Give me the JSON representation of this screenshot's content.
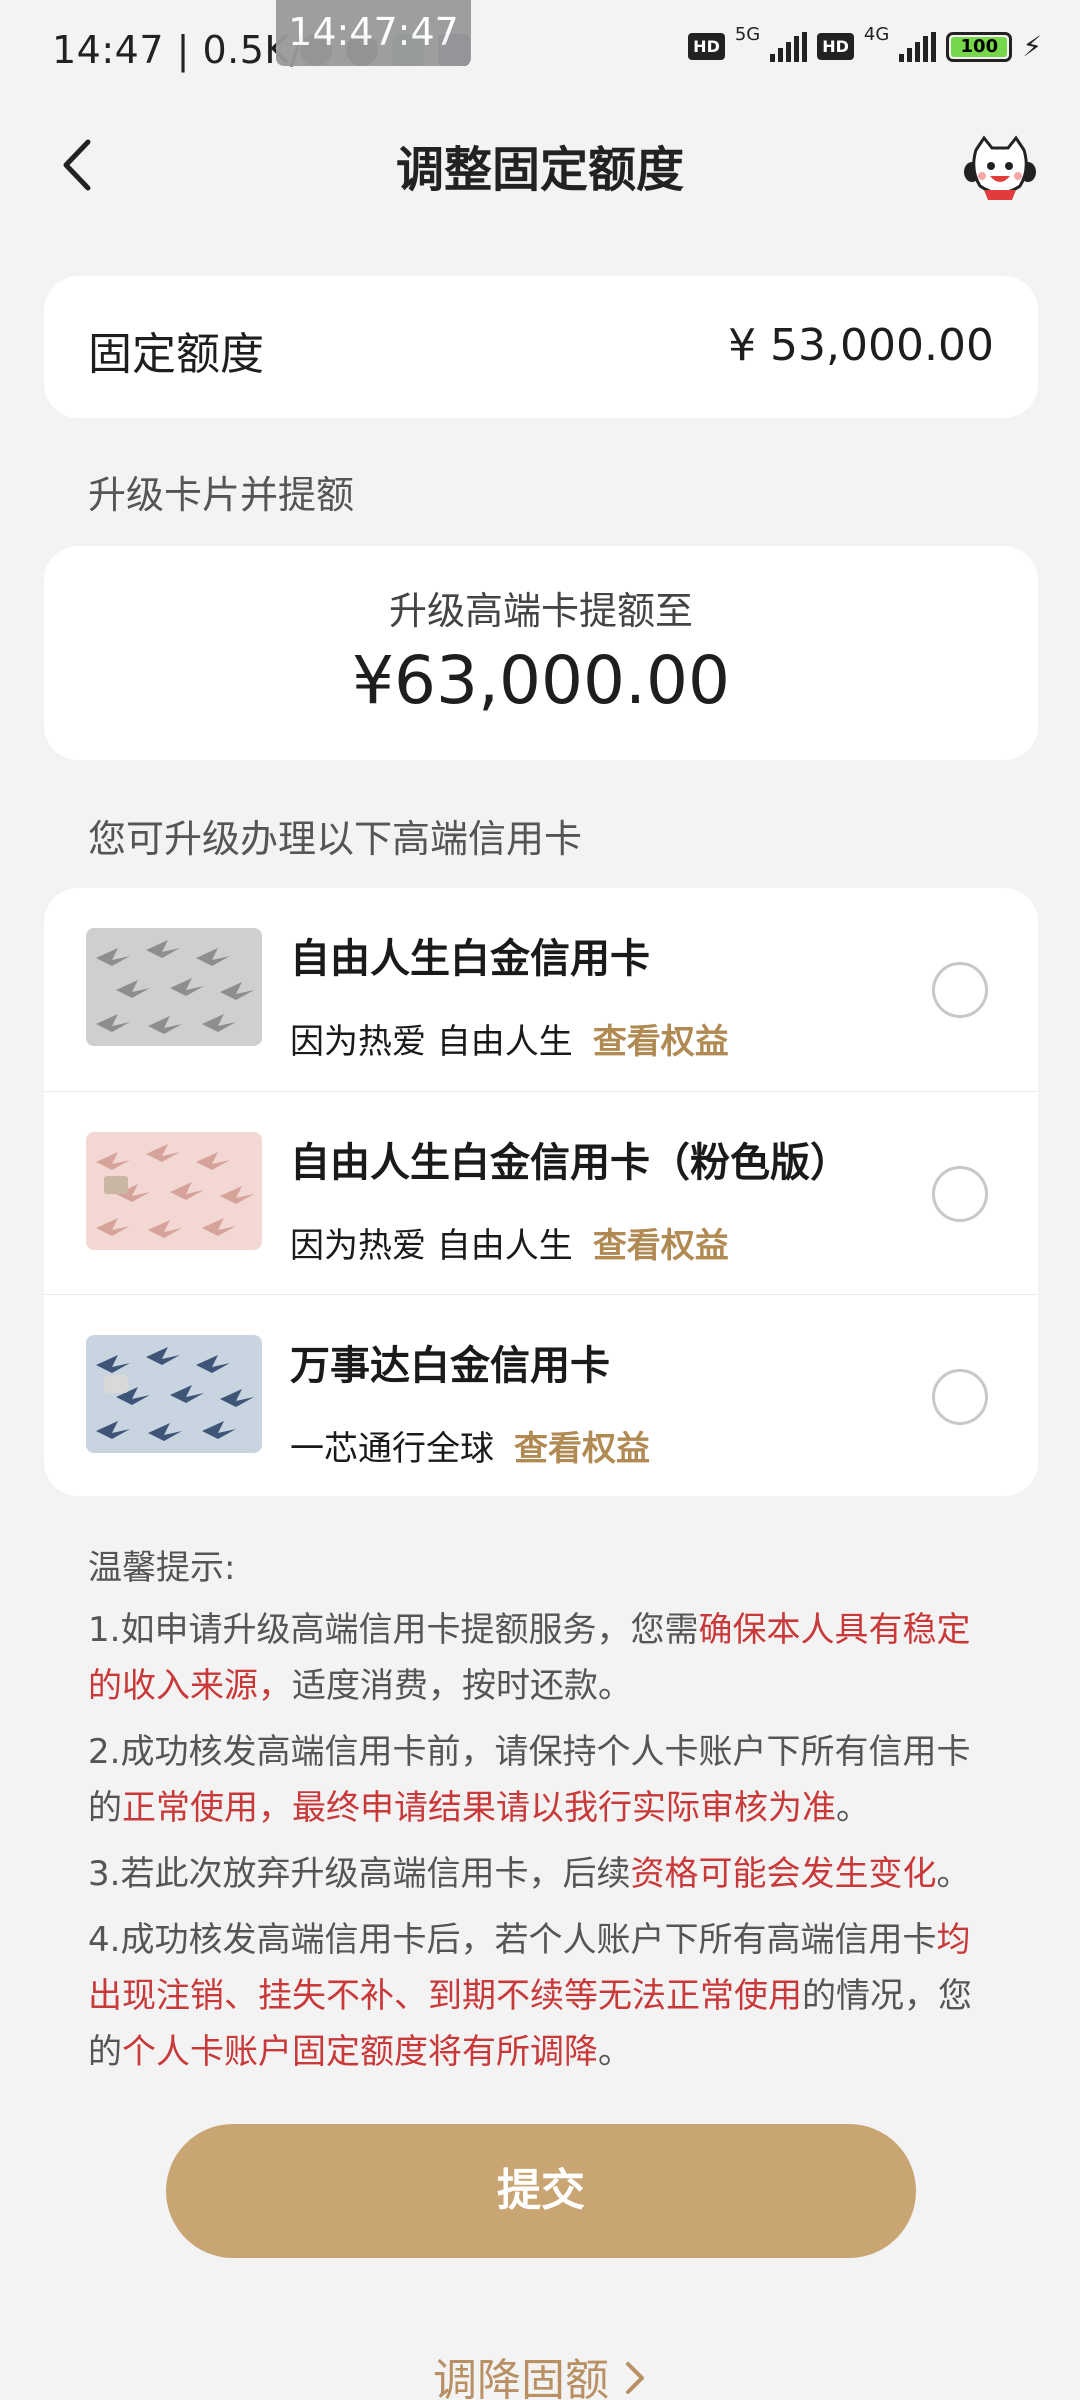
{
  "status_bar": {
    "time_speed": "14:47 | 0.5K/s",
    "clock_bubble": "14:47:47",
    "net1": "5G",
    "net2": "4G",
    "hd": "HD",
    "battery": "100"
  },
  "header": {
    "title": "调整固定额度"
  },
  "fixed_limit": {
    "label": "固定额度",
    "value": "¥ 53,000.00"
  },
  "upgrade_section": {
    "title": "升级卡片并提额",
    "label": "升级高端卡提额至",
    "value": "¥63,000.00"
  },
  "cards_section": {
    "title": "您可升级办理以下高端信用卡",
    "items": [
      {
        "name": "自由人生白金信用卡",
        "slogan": "因为热爱 自由人生",
        "link": "查看权益"
      },
      {
        "name": "自由人生白金信用卡（粉色版）",
        "slogan": "因为热爱 自由人生",
        "link": "查看权益"
      },
      {
        "name": "万事达白金信用卡",
        "slogan": "一芯通行全球",
        "link": "查看权益"
      }
    ]
  },
  "tips": {
    "title": "温馨提示:",
    "t1_a": "1.如申请升级高端信用卡提额服务，您需",
    "t1_b": "确保本人具有稳定的收入来源，",
    "t1_c": "适度消费，按时还款。",
    "t2_a": "2.成功核发高端信用卡前，请保持个人卡账户下所有信用卡的",
    "t2_b": "正常使用，最终申请结果请以我行实际审核为准",
    "t2_c": "。",
    "t3_a": "3.若此次放弃升级高端信用卡，后续",
    "t3_b": "资格可能会发生变化",
    "t3_c": "。",
    "t4_a": "4.成功核发高端信用卡后，若个人账户下所有高端信用卡",
    "t4_b": "均出现注销、挂失不补、到期不续等无法正常使用",
    "t4_c": "的情况，您的",
    "t4_d": "个人卡账户固定额度将有所调降",
    "t4_e": "。"
  },
  "actions": {
    "submit": "提交",
    "reduce": "调降固额"
  },
  "colors": {
    "accent_gold": "#c9a574",
    "link_gold": "#b08a52",
    "warning_red": "#c9393a"
  }
}
